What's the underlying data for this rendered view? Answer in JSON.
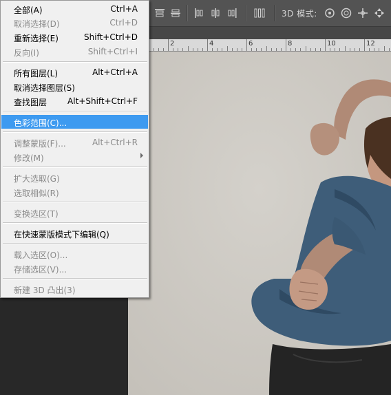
{
  "options_bar": {
    "mode_label": "3D 模式:",
    "icons": [
      "align-top-edges-icon",
      "align-vertical-centers-icon",
      "align-bottom-edges-icon",
      "align-left-edges-icon",
      "align-horizontal-centers-icon",
      "align-right-edges-icon",
      "distribute-icon",
      "rotate-3d-icon",
      "roll-3d-icon",
      "drag-3d-icon",
      "slide-3d-icon"
    ]
  },
  "ruler": {
    "labels": [
      "2",
      "4",
      "6",
      "8",
      "10",
      "12"
    ]
  },
  "menu": {
    "items": [
      {
        "label": "全部(A)",
        "shortcut": "Ctrl+A",
        "disabled": false
      },
      {
        "label": "取消选择(D)",
        "shortcut": "Ctrl+D",
        "disabled": true
      },
      {
        "label": "重新选择(E)",
        "shortcut": "Shift+Ctrl+D",
        "disabled": false
      },
      {
        "label": "反向(I)",
        "shortcut": "Shift+Ctrl+I",
        "disabled": true
      },
      {
        "label": "所有图层(L)",
        "shortcut": "Alt+Ctrl+A",
        "disabled": false
      },
      {
        "label": "取消选择图层(S)",
        "shortcut": "",
        "disabled": false
      },
      {
        "label": "查找图层",
        "shortcut": "Alt+Shift+Ctrl+F",
        "disabled": false
      },
      {
        "label": "色彩范围(C)...",
        "shortcut": "",
        "disabled": false,
        "highlight": true
      },
      {
        "label": "调整蒙版(F)...",
        "shortcut": "Alt+Ctrl+R",
        "disabled": true
      },
      {
        "label": "修改(M)",
        "shortcut": "",
        "disabled": true,
        "submenu": true
      },
      {
        "label": "扩大选取(G)",
        "shortcut": "",
        "disabled": true
      },
      {
        "label": "选取相似(R)",
        "shortcut": "",
        "disabled": true
      },
      {
        "label": "变换选区(T)",
        "shortcut": "",
        "disabled": true
      },
      {
        "label": "在快速蒙版模式下编辑(Q)",
        "shortcut": "",
        "disabled": false
      },
      {
        "label": "载入选区(O)...",
        "shortcut": "",
        "disabled": true
      },
      {
        "label": "存储选区(V)...",
        "shortcut": "",
        "disabled": true
      },
      {
        "label": "新建 3D 凸出(3)",
        "shortcut": "",
        "disabled": true
      }
    ]
  },
  "colors": {
    "menu_highlight": "#3d9af0",
    "menu_bg": "#f0f0f0",
    "disabled_text": "#8a8a8a",
    "panel_bg": "#535353"
  }
}
